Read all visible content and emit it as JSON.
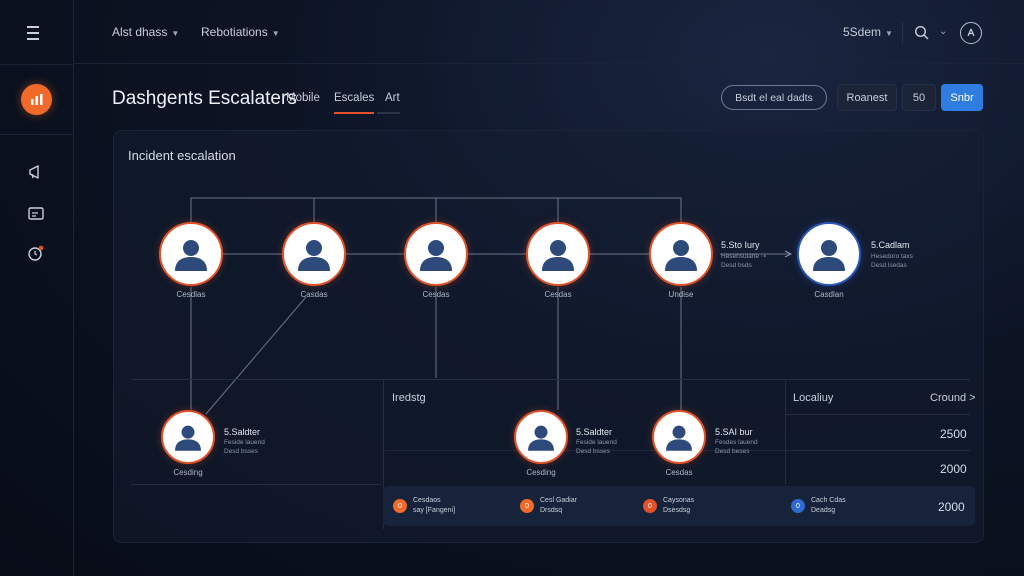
{
  "header": {
    "menus": [
      {
        "label": "Alst dhass"
      },
      {
        "label": "Rebotiations"
      }
    ],
    "user_menu": "5Sdem",
    "search_chevron": "⌄"
  },
  "page": {
    "title": "Dashgents Escalaters",
    "tabs": [
      {
        "label": "Mobile"
      },
      {
        "label": "Escales"
      },
      {
        "label": "Art"
      }
    ],
    "search_placeholder": "Bsdt el eal dadts",
    "buttons": {
      "secondary": "Roanest",
      "tertiary": "50",
      "primary": "Snbr"
    }
  },
  "panel": {
    "title": "Incident escalation",
    "top_nodes": [
      {
        "label": "Cesdlas"
      },
      {
        "label": "Casdas"
      },
      {
        "label": "Cesdas"
      },
      {
        "label": "Cesdas"
      },
      {
        "label": "Undise"
      },
      {
        "label": "Casdlan"
      }
    ],
    "top_side_info": [
      {
        "name": "5.Sto Iury",
        "sub": [
          "Hesensulane ⇢",
          "Desd bsds"
        ]
      },
      {
        "name": "5.Cadlam",
        "sub": [
          "Hesedoro taxs",
          "Desd lsedas"
        ]
      }
    ],
    "bottom_nodes": [
      {
        "label": "Cesding",
        "name": "5.Saldter",
        "sub": [
          "Feside lauend",
          "Desd bsses"
        ]
      },
      {
        "label": "Cesding",
        "name": "5.Saldter",
        "sub": [
          "Feside lauend",
          "Desd bsses"
        ]
      },
      {
        "label": "Cesdas",
        "name": "5.SAI bur",
        "sub": [
          "Fesdes lauend",
          "Desd beses"
        ]
      }
    ],
    "columns": {
      "middle": "Iredstg",
      "right": "Localiuy",
      "count": "Cround >"
    },
    "values": [
      "2500",
      "2000",
      "2000"
    ],
    "strip": [
      {
        "glyph": "0",
        "color": "#f26a2a",
        "lines": [
          "Cesdaos",
          "say [Fangeni]"
        ]
      },
      {
        "glyph": "0",
        "color": "#f26a2a",
        "lines": [
          "Cesl Gadiar",
          "Drsdsq"
        ]
      },
      {
        "glyph": "0",
        "color": "#e0532a",
        "lines": [
          "Caysonas",
          "Dsesdsg"
        ]
      },
      {
        "glyph": "0",
        "color": "#2f6ad0",
        "lines": [
          "Cach Cdas",
          "Deadsg"
        ]
      }
    ]
  }
}
